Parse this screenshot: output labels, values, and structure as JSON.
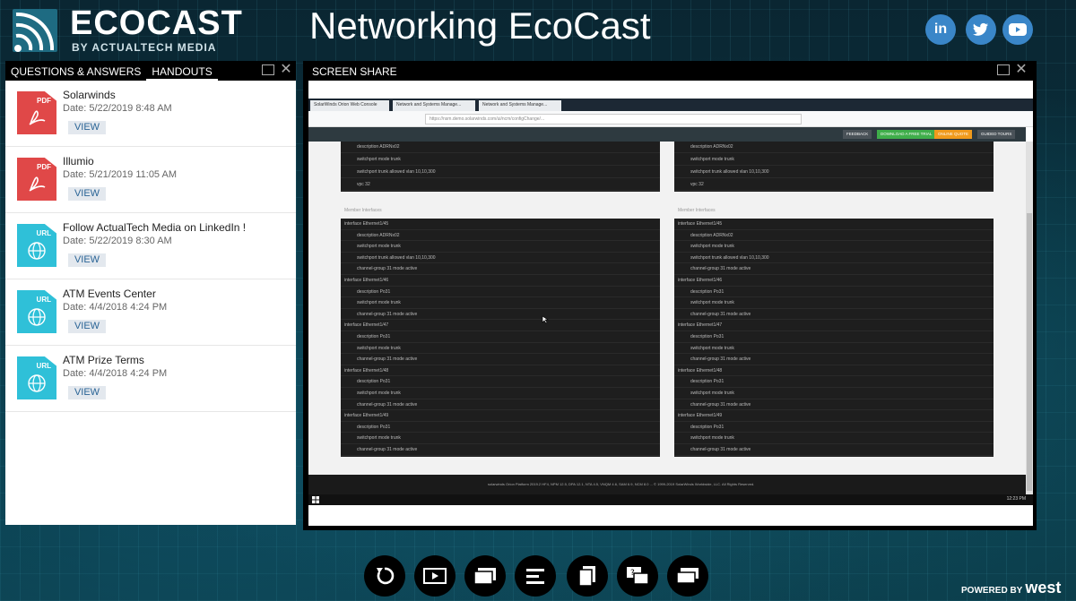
{
  "header": {
    "logo_text": "ECOCAST",
    "logo_sub": "BY ACTUALTECH MEDIA",
    "title": "Networking EcoCast",
    "social": [
      "in",
      "t",
      "yt"
    ]
  },
  "left_panel": {
    "tabs": [
      "QUESTIONS & ANSWERS",
      "HANDOUTS"
    ],
    "active_tab": "HANDOUTS",
    "items": [
      {
        "type": "PDF",
        "title": "Solarwinds",
        "date": "Date: 5/22/2019 8:48 AM",
        "action": "VIEW"
      },
      {
        "type": "PDF",
        "title": "Illumio",
        "date": "Date: 5/21/2019 11:05 AM",
        "action": "VIEW"
      },
      {
        "type": "URL",
        "title": "Follow ActualTech Media on LinkedIn !",
        "date": "Date: 5/22/2019 8:30 AM",
        "action": "VIEW"
      },
      {
        "type": "URL",
        "title": "ATM Events Center",
        "date": "Date: 4/4/2018 4:24 PM",
        "action": "VIEW"
      },
      {
        "type": "URL",
        "title": "ATM Prize Terms",
        "date": "Date: 4/4/2018 4:24 PM",
        "action": "VIEW"
      }
    ]
  },
  "screen_share": {
    "title": "SCREEN SHARE",
    "browser_tabs": [
      "SolarWinds Orion Web Console",
      "Network and Systems Manage...",
      "Network and Systems Manage..."
    ],
    "url": "https://nsm.demo.solarwinds.com/ui/ncm/configChange/...",
    "app_buttons": [
      "FEEDBACK",
      "DOWNLOAD A FREE TRIAL",
      "ONLINE QUOTE",
      "GUIDED TOURS"
    ],
    "section_label": "Member Interfaces",
    "left_top_lines": [
      "description ADRNx02",
      "switchport mode trunk",
      "switchport trunk allowed vlan 10,10,300",
      "vpc 32"
    ],
    "right_top_lines": [
      "description ADRNx02",
      "switchport mode trunk",
      "switchport trunk allowed vlan 10,10,300",
      "vpc 32"
    ],
    "member_lines": [
      {
        "text": "interface Ethernet1/45",
        "indent": false
      },
      {
        "text": "description ADRNx02",
        "indent": true
      },
      {
        "text": "switchport mode trunk",
        "indent": true
      },
      {
        "text": "switchport trunk allowed vlan 10,10,300",
        "indent": true
      },
      {
        "text": "channel-group 31 mode active",
        "indent": true
      },
      {
        "text": "interface Ethernet1/46",
        "indent": false
      },
      {
        "text": "description Po31",
        "indent": true
      },
      {
        "text": "switchport mode trunk",
        "indent": true
      },
      {
        "text": "channel-group 31 mode active",
        "indent": true
      },
      {
        "text": "interface Ethernet1/47",
        "indent": false
      },
      {
        "text": "description Po31",
        "indent": true
      },
      {
        "text": "switchport mode trunk",
        "indent": true
      },
      {
        "text": "channel-group 31 mode active",
        "indent": true
      },
      {
        "text": "interface Ethernet1/48",
        "indent": false
      },
      {
        "text": "description Po31",
        "indent": true
      },
      {
        "text": "switchport mode trunk",
        "indent": true
      },
      {
        "text": "channel-group 31 mode active",
        "indent": true
      },
      {
        "text": "interface Ethernet1/49",
        "indent": false
      },
      {
        "text": "description Po31",
        "indent": true
      },
      {
        "text": "switchport mode trunk",
        "indent": true
      },
      {
        "text": "channel-group 31 mode active",
        "indent": true
      }
    ],
    "footer": "solarwinds   Orion Platform 2019.2 HF4, NPM 12.5, DPA 12.1, NTA 4.5, VNQM 4.6, SAM 6.9, NCM 8.0 ... © 1999-2019 SolarWinds Worldwide, LLC. All Rights Reserved.",
    "clock": "12:23 PM"
  },
  "controls": [
    "refresh-icon",
    "play-icon",
    "slides-icon",
    "agenda-icon",
    "handouts-icon",
    "qa-icon",
    "chat-icon"
  ],
  "powered_by": {
    "label": "POWERED BY",
    "brand": "west"
  },
  "colors": {
    "pdf": "#e04848",
    "url": "#2fc0d8",
    "view_text": "#2a6496",
    "accent": "#3a86c8"
  }
}
